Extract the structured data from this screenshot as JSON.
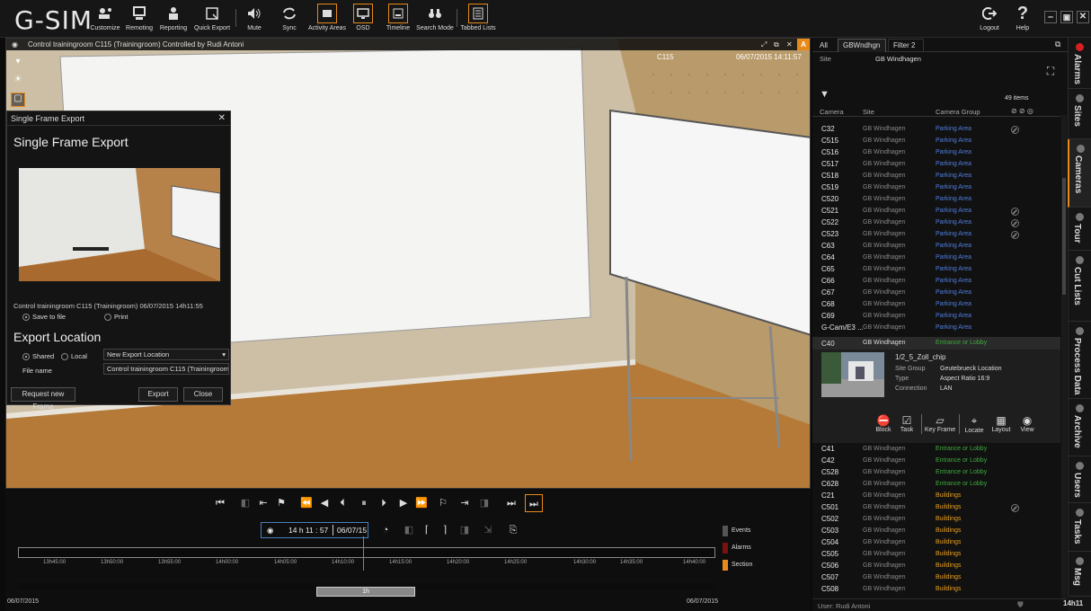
{
  "app": {
    "logo": "G-SIM"
  },
  "toolbar": {
    "customize": "Customize",
    "remoting": "Remoting",
    "reporting": "Reporting",
    "quick_export": "Quick Export",
    "mute": "Mute",
    "sync": "Sync",
    "activity_areas": "Activity Areas",
    "osd": "OSD",
    "timeline": "Timeline",
    "search_mode": "Search Mode",
    "tabbed_lists": "Tabbed Lists",
    "logout": "Logout",
    "help": "Help",
    "accent": "#e88a1a"
  },
  "video": {
    "title": "Control trainingroom C115 (Trainingroom) Controlled by Rudi Antoni",
    "osd_camera": "C115",
    "osd_time": "06/07/2015 14:11:57",
    "badge": "A"
  },
  "export_dialog": {
    "window_title": "Single Frame Export",
    "heading": "Single Frame Export",
    "caption": "Control trainingroom C115 (Trainingroom) 06/07/2015 14h11:55",
    "save_to_file": "Save to file",
    "print": "Print",
    "export_location_heading": "Export Location",
    "shared": "Shared",
    "local": "Local",
    "location_select": "New Export Location",
    "file_name_label": "File name",
    "file_name_value": "Control trainingroom C115 (Trainingroom",
    "request_new_frame": "Request new Frame",
    "export": "Export",
    "close": "Close"
  },
  "playback": {
    "time": "14 h 11 : 57",
    "date": "06/07/15",
    "ticks": [
      "13h45:00",
      "13h50:00",
      "13h55:00",
      "14h00:00",
      "14h05:00",
      "14h10:00",
      "14h15:00",
      "14h20:00",
      "14h25:00",
      "14h30:00",
      "14h35:00",
      "14h40:00"
    ],
    "start_date": "06/07/2015",
    "end_date": "06/07/2015",
    "range_label": "1h",
    "legend": [
      {
        "label": "Events",
        "color": "#555555"
      },
      {
        "label": "Alarms",
        "color": "#7a1010"
      },
      {
        "label": "Section",
        "color": "#e88a1a"
      }
    ]
  },
  "right_panel": {
    "filter_tabs": [
      "All",
      "GBWndhgn",
      "Filter 2"
    ],
    "site_label": "Site",
    "site_value": "GB Windhagen",
    "items_count": "49 items",
    "columns": {
      "camera": "Camera",
      "site": "Site",
      "group": "Camera Group"
    },
    "rows_top": [
      {
        "cam": "C32",
        "site": "GB Windhagen",
        "grp": "Parking Area",
        "ban": true
      },
      {
        "cam": "C515",
        "site": "GB Windhagen",
        "grp": "Parking Area",
        "ban": false
      },
      {
        "cam": "C516",
        "site": "GB Windhagen",
        "grp": "Parking Area",
        "ban": false
      },
      {
        "cam": "C517",
        "site": "GB Windhagen",
        "grp": "Parking Area",
        "ban": false
      },
      {
        "cam": "C518",
        "site": "GB Windhagen",
        "grp": "Parking Area",
        "ban": false
      },
      {
        "cam": "C519",
        "site": "GB Windhagen",
        "grp": "Parking Area",
        "ban": false
      },
      {
        "cam": "C520",
        "site": "GB Windhagen",
        "grp": "Parking Area",
        "ban": false
      },
      {
        "cam": "C521",
        "site": "GB Windhagen",
        "grp": "Parking Area",
        "ban": true
      },
      {
        "cam": "C522",
        "site": "GB Windhagen",
        "grp": "Parking Area",
        "ban": true
      },
      {
        "cam": "C523",
        "site": "GB Windhagen",
        "grp": "Parking Area",
        "ban": true
      },
      {
        "cam": "C63",
        "site": "GB Windhagen",
        "grp": "Parking Area",
        "ban": false
      },
      {
        "cam": "C64",
        "site": "GB Windhagen",
        "grp": "Parking Area",
        "ban": false
      },
      {
        "cam": "C65",
        "site": "GB Windhagen",
        "grp": "Parking Area",
        "ban": false
      },
      {
        "cam": "C66",
        "site": "GB Windhagen",
        "grp": "Parking Area",
        "ban": false
      },
      {
        "cam": "C67",
        "site": "GB Windhagen",
        "grp": "Parking Area",
        "ban": false
      },
      {
        "cam": "C68",
        "site": "GB Windhagen",
        "grp": "Parking Area",
        "ban": false
      },
      {
        "cam": "C69",
        "site": "GB Windhagen",
        "grp": "Parking Area",
        "ban": false
      },
      {
        "cam": "G-Cam/E3 ...",
        "site": "GB Windhagen",
        "grp": "Parking Area",
        "ban": false
      }
    ],
    "selected": {
      "cam": "C40",
      "site": "GB Windhagen",
      "grp": "Entrance or Lobby",
      "name": "1/2_5_Zoll_chip",
      "site_group_label": "Site Group",
      "site_group": "Geutebrueck Location",
      "type_label": "Type",
      "type": "Aspect Ratio 16:9",
      "connection_label": "Connection",
      "connection": "LAN",
      "actions": [
        "Block",
        "Task",
        "Key Frame",
        "Locate",
        "Layout",
        "View"
      ]
    },
    "rows_bottom": [
      {
        "cam": "C41",
        "site": "GB Windhagen",
        "grp": "Entrance or Lobby",
        "ban": false
      },
      {
        "cam": "C42",
        "site": "GB Windhagen",
        "grp": "Entrance or Lobby",
        "ban": false
      },
      {
        "cam": "C528",
        "site": "GB Windhagen",
        "grp": "Entrance or Lobby",
        "ban": false
      },
      {
        "cam": "C628",
        "site": "GB Windhagen",
        "grp": "Entrance or Lobby",
        "ban": false
      },
      {
        "cam": "C21",
        "site": "GB Windhagen",
        "grp": "Buildings",
        "ban": false
      },
      {
        "cam": "C501",
        "site": "GB Windhagen",
        "grp": "Buildings",
        "ban": true
      },
      {
        "cam": "C502",
        "site": "GB Windhagen",
        "grp": "Buildings",
        "ban": false
      },
      {
        "cam": "C503",
        "site": "GB Windhagen",
        "grp": "Buildings",
        "ban": false
      },
      {
        "cam": "C504",
        "site": "GB Windhagen",
        "grp": "Buildings",
        "ban": false
      },
      {
        "cam": "C505",
        "site": "GB Windhagen",
        "grp": "Buildings",
        "ban": false
      },
      {
        "cam": "C506",
        "site": "GB Windhagen",
        "grp": "Buildings",
        "ban": false
      },
      {
        "cam": "C507",
        "site": "GB Windhagen",
        "grp": "Buildings",
        "ban": false
      },
      {
        "cam": "C508",
        "site": "GB Windhagen",
        "grp": "Buildings",
        "ban": false
      }
    ],
    "group_colors": {
      "Parking Area": "#4f7fe0",
      "Entrance or Lobby": "#3faa3f",
      "Buildings": "#e8a020"
    },
    "status_user": "User: Rudi Antoni",
    "status_time": "14h11"
  },
  "side_tabs": [
    {
      "label": "Alarms",
      "dot": "#d62020"
    },
    {
      "label": "Sites",
      "dot": "#777777"
    },
    {
      "label": "Cameras",
      "dot": "#777777"
    },
    {
      "label": "Tour",
      "dot": "#777777"
    },
    {
      "label": "Cut Lists",
      "dot": "#777777"
    },
    {
      "label": "Process Data",
      "dot": "#777777"
    },
    {
      "label": "Archive",
      "dot": "#777777"
    },
    {
      "label": "Users",
      "dot": "#777777"
    },
    {
      "label": "Tasks",
      "dot": "#777777"
    },
    {
      "label": "Msg",
      "dot": "#777777"
    }
  ]
}
